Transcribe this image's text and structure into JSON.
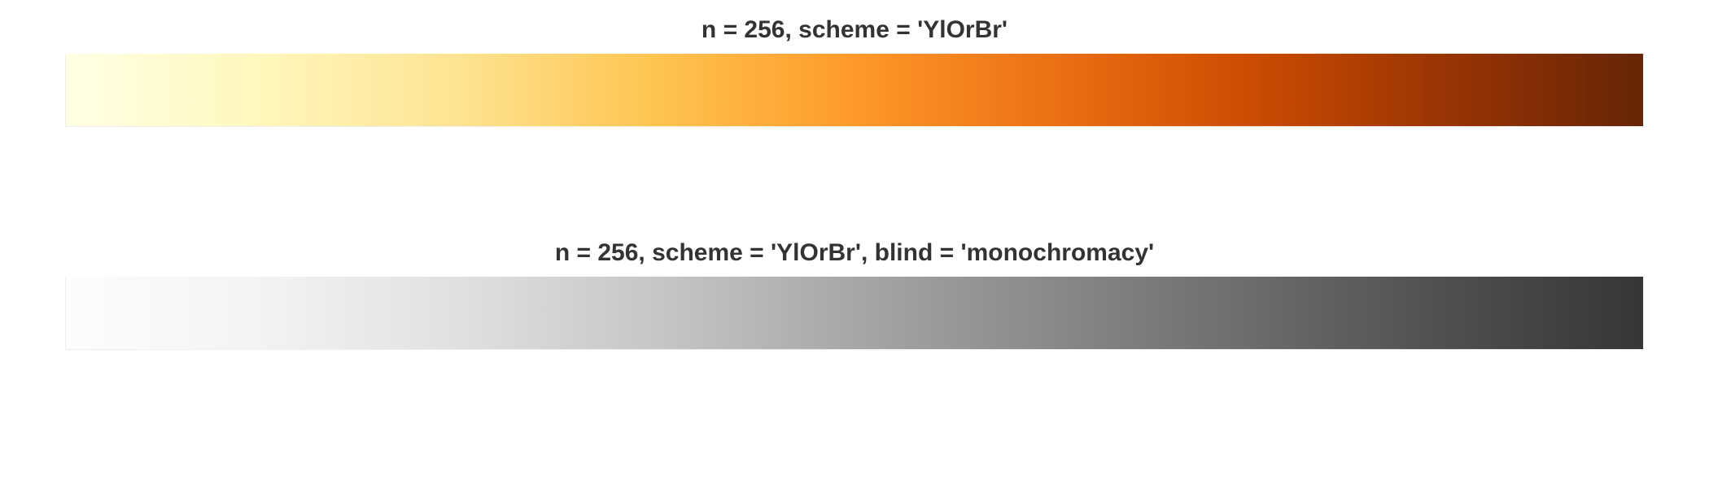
{
  "charts": [
    {
      "title": "n = 256, scheme = 'YlOrBr'"
    },
    {
      "title": "n = 256, scheme = 'YlOrBr', blind = 'monochromacy'"
    }
  ],
  "chart_data": [
    {
      "type": "heatmap",
      "title": "n = 256, scheme = 'YlOrBr'",
      "n": 256,
      "scheme": "YlOrBr",
      "gradient_stops": [
        {
          "pos": 0.0,
          "hex": "#FFFFE5"
        },
        {
          "pos": 0.125,
          "hex": "#FFF7BC"
        },
        {
          "pos": 0.25,
          "hex": "#FEE391"
        },
        {
          "pos": 0.375,
          "hex": "#FEC44F"
        },
        {
          "pos": 0.5,
          "hex": "#FE9929"
        },
        {
          "pos": 0.625,
          "hex": "#EC7014"
        },
        {
          "pos": 0.75,
          "hex": "#CC4C02"
        },
        {
          "pos": 0.875,
          "hex": "#993404"
        },
        {
          "pos": 1.0,
          "hex": "#662506"
        }
      ],
      "xlabel": "",
      "ylabel": "",
      "xlim": [
        0,
        256
      ],
      "ylim": [
        0,
        1
      ]
    },
    {
      "type": "heatmap",
      "title": "n = 256, scheme = 'YlOrBr', blind = 'monochromacy'",
      "n": 256,
      "scheme": "YlOrBr",
      "blind": "monochromacy",
      "gradient_stops": [
        {
          "pos": 0.0,
          "hex": "#FDFDFD"
        },
        {
          "pos": 0.125,
          "hex": "#F3F3F3"
        },
        {
          "pos": 0.25,
          "hex": "#E0E0E0"
        },
        {
          "pos": 0.375,
          "hex": "#C6C6C6"
        },
        {
          "pos": 0.5,
          "hex": "#A7A7A7"
        },
        {
          "pos": 0.625,
          "hex": "#898989"
        },
        {
          "pos": 0.75,
          "hex": "#6C6C6C"
        },
        {
          "pos": 0.875,
          "hex": "#4F4F4F"
        },
        {
          "pos": 1.0,
          "hex": "#363636"
        }
      ],
      "xlabel": "",
      "ylabel": "",
      "xlim": [
        0,
        256
      ],
      "ylim": [
        0,
        1
      ]
    }
  ]
}
